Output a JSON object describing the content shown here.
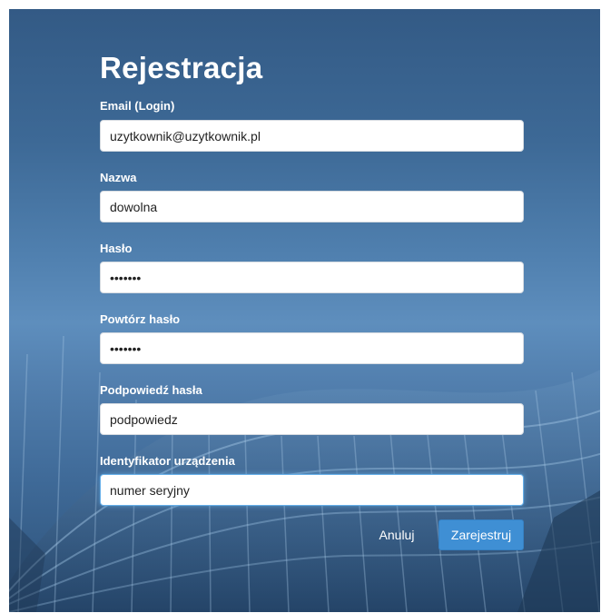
{
  "form": {
    "title": "Rejestracja",
    "fields": [
      {
        "label": "Email (Login)",
        "value": "uzytkownik@uzytkownik.pl",
        "type": "text"
      },
      {
        "label": "Nazwa",
        "value": "dowolna",
        "type": "text"
      },
      {
        "label": "Hasło",
        "value": "•••••••",
        "type": "password"
      },
      {
        "label": "Powtórz hasło",
        "value": "•••••••",
        "type": "password"
      },
      {
        "label": "Podpowiedź hasła",
        "value": "podpowiedz",
        "type": "text"
      },
      {
        "label": "Identyfikator urządzenia",
        "value": "numer seryjny",
        "type": "text",
        "focused": true
      }
    ],
    "buttons": {
      "cancel_label": "Anuluj",
      "submit_label": "Zarejestruj"
    }
  },
  "colors": {
    "primary_button": "#3f8fd4",
    "focus_border": "#66afe9",
    "background_blue": "#4a79a8"
  }
}
